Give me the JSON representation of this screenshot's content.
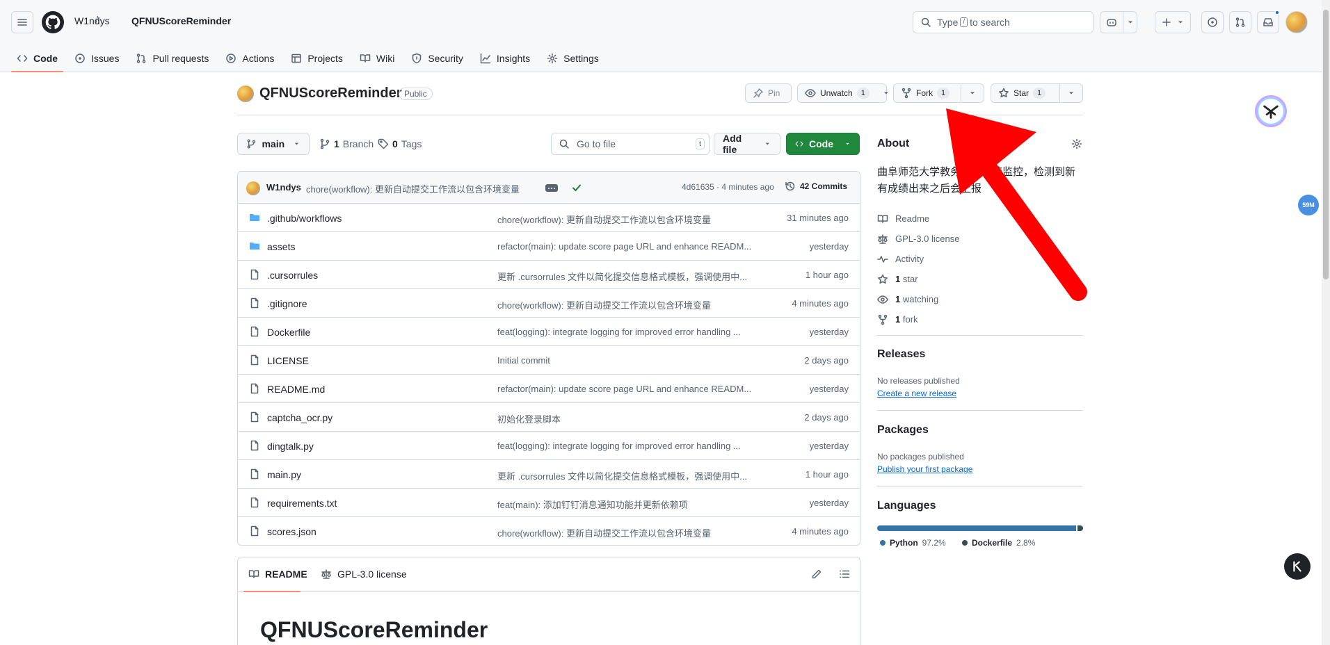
{
  "header": {
    "owner": "W1ndys",
    "separator": "/",
    "repo": "QFNUScoreReminder",
    "search_prefix": "Type",
    "search_key": "/",
    "search_suffix": "to search"
  },
  "tabs": [
    {
      "label": "Code",
      "icon": "code-icon"
    },
    {
      "label": "Issues",
      "icon": "issue-icon"
    },
    {
      "label": "Pull requests",
      "icon": "pull-request-icon"
    },
    {
      "label": "Actions",
      "icon": "play-icon"
    },
    {
      "label": "Projects",
      "icon": "table-icon"
    },
    {
      "label": "Wiki",
      "icon": "book-icon"
    },
    {
      "label": "Security",
      "icon": "shield-icon"
    },
    {
      "label": "Insights",
      "icon": "graph-icon"
    },
    {
      "label": "Settings",
      "icon": "gear-icon"
    }
  ],
  "repo": {
    "name": "QFNUScoreReminder",
    "visibility": "Public",
    "pin_label": "Pin",
    "watch_label": "Unwatch",
    "watch_count": "1",
    "fork_label": "Fork",
    "fork_count": "1",
    "star_label": "Star",
    "star_count": "1"
  },
  "branchbar": {
    "branch": "main",
    "branches_count": "1",
    "branches_label": "Branch",
    "tags_count": "0",
    "tags_label": "Tags",
    "goto_placeholder": "Go to file",
    "goto_key": "t",
    "add_file_label": "Add file",
    "code_label": "Code"
  },
  "commit": {
    "author": "W1ndys",
    "message": "chore(workflow): 更新自动提交工作流以包含环境变量",
    "hash_time": "4d61635 · 4 minutes ago",
    "commits_count": "42 Commits"
  },
  "files": [
    {
      "name": ".github/workflows",
      "type": "dir",
      "message": "chore(workflow): 更新自动提交工作流以包含环境变量",
      "time": "31 minutes ago"
    },
    {
      "name": "assets",
      "type": "dir",
      "message": "refactor(main): update score page URL and enhance READM...",
      "time": "yesterday"
    },
    {
      "name": ".cursorrules",
      "type": "file",
      "message": "更新 .cursorrules 文件以简化提交信息格式模板，强调使用中...",
      "time": "1 hour ago"
    },
    {
      "name": ".gitignore",
      "type": "file",
      "message": "chore(workflow): 更新自动提交工作流以包含环境变量",
      "time": "4 minutes ago"
    },
    {
      "name": "Dockerfile",
      "type": "file",
      "message": "feat(logging): integrate logging for improved error handling ...",
      "time": "yesterday"
    },
    {
      "name": "LICENSE",
      "type": "file",
      "message": "Initial commit",
      "time": "2 days ago"
    },
    {
      "name": "README.md",
      "type": "file",
      "message": "refactor(main): update score page URL and enhance READM...",
      "time": "yesterday"
    },
    {
      "name": "captcha_ocr.py",
      "type": "file",
      "message": "初始化登录脚本",
      "time": "2 days ago"
    },
    {
      "name": "dingtalk.py",
      "type": "file",
      "message": "feat(logging): integrate logging for improved error handling ...",
      "time": "yesterday"
    },
    {
      "name": "main.py",
      "type": "file",
      "message": "更新 .cursorrules 文件以简化提交信息格式模板，强调使用中...",
      "time": "1 hour ago"
    },
    {
      "name": "requirements.txt",
      "type": "file",
      "message": "feat(main): 添加钉钉消息通知功能并更新依赖项",
      "time": "yesterday"
    },
    {
      "name": "scores.json",
      "type": "file",
      "message": "chore(workflow): 更新自动提交工作流以包含环境变量",
      "time": "4 minutes ago"
    }
  ],
  "readme": {
    "tab_readme": "README",
    "tab_license": "GPL-3.0 license",
    "heading": "QFNUScoreReminder"
  },
  "about": {
    "title": "About",
    "description": "曲阜师范大学教务系统成绩监控，检测到新有成绩出来之后会上报",
    "meta": [
      {
        "icon": "book-icon",
        "bold": "",
        "text": "Readme"
      },
      {
        "icon": "law-icon",
        "bold": "",
        "text": "GPL-3.0 license"
      },
      {
        "icon": "pulse-icon",
        "bold": "",
        "text": "Activity"
      },
      {
        "icon": "star-icon",
        "bold": "1",
        "text": "star"
      },
      {
        "icon": "eye-icon",
        "bold": "1",
        "text": "watching"
      },
      {
        "icon": "fork-icon",
        "bold": "1",
        "text": "fork"
      }
    ]
  },
  "releases": {
    "title": "Releases",
    "empty": "No releases published",
    "link": "Create a new release"
  },
  "packages": {
    "title": "Packages",
    "empty": "No packages published",
    "link": "Publish your first package"
  },
  "languages": {
    "title": "Languages",
    "items": [
      {
        "name": "Python",
        "percent": "97.2%",
        "value": 97.2,
        "color": "#3572A5"
      },
      {
        "name": "Dockerfile",
        "percent": "2.8%",
        "value": 2.8,
        "color": "#384d54"
      }
    ]
  },
  "overlay": {
    "badge_text": "59M",
    "arrow_color": "#ff0000"
  }
}
